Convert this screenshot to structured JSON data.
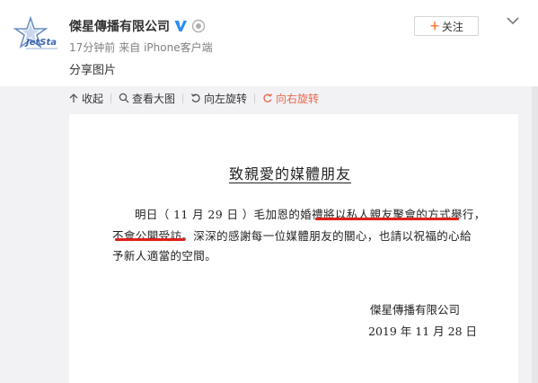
{
  "post": {
    "username": "傑星傳播有限公司",
    "avatar_text": "JetSta",
    "time": "17分钟前",
    "source": "来自 iPhone客户端",
    "text": "分享图片",
    "follow_label": "关注"
  },
  "toolbar": {
    "collapse": "收起",
    "view_large": "查看大图",
    "rotate_left": "向左旋转",
    "rotate_right": "向右旋转"
  },
  "document": {
    "title": "致親愛的媒體朋友",
    "line1": "明日（ 11 月 29 日 ）毛加恩的婚禮將以私人親友聚會的方式舉行，",
    "line2": "不會公開受訪。深深的感謝每一位媒體朋友的關心，也請以祝福的心給",
    "line3": "予新人適當的空間。",
    "company": "傑星傳播有限公司",
    "date": "2019 年 11 月 28 日"
  },
  "colors": {
    "accent_red": "#e0201a",
    "verified_blue": "#2d8cf0",
    "follow_plus": "#ff8140",
    "active_tool": "#e8684a"
  },
  "icons": [
    "jetstar-logo-icon",
    "verified-v-icon",
    "level-badge-icon",
    "plus-icon",
    "chevron-down-icon",
    "collapse-icon",
    "magnifier-icon",
    "rotate-left-icon",
    "rotate-right-icon"
  ]
}
